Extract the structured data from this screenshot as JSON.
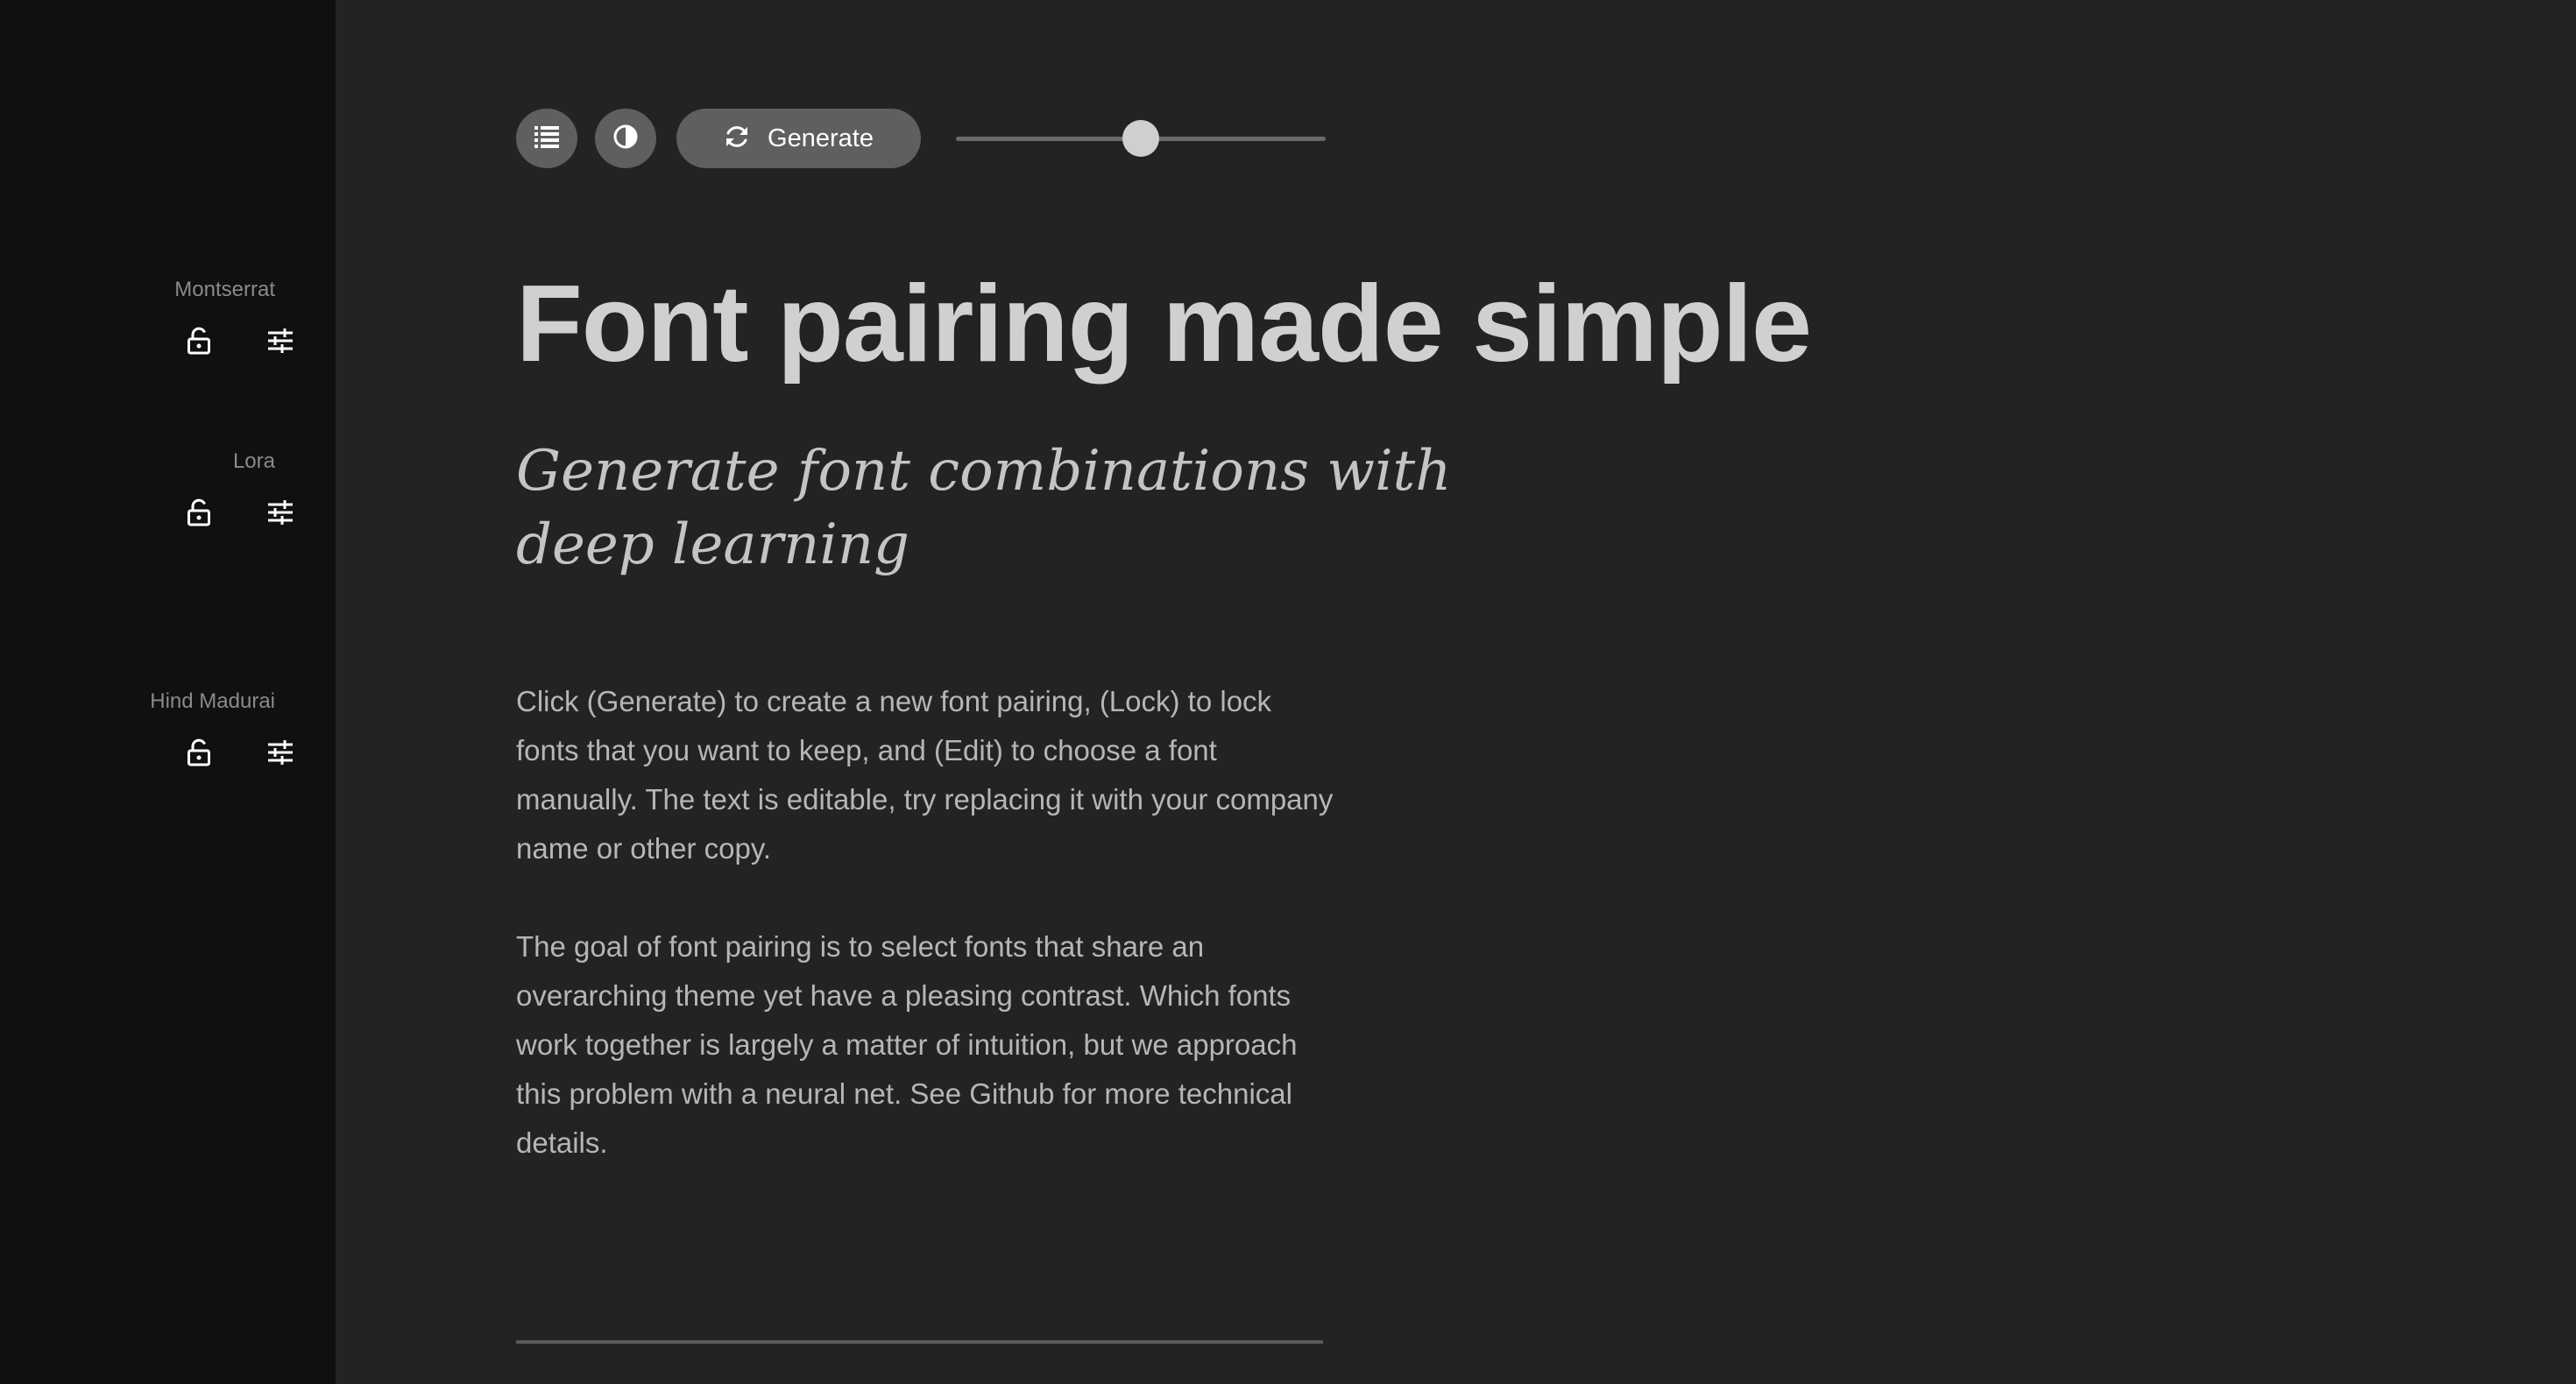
{
  "sidebar": {
    "fonts": [
      {
        "name": "Montserrat"
      },
      {
        "name": "Lora"
      },
      {
        "name": "Hind Madurai"
      }
    ]
  },
  "toolbar": {
    "list_icon": "list-icon",
    "contrast_icon": "contrast-icon",
    "generate_label": "Generate",
    "generate_icon": "refresh-icon",
    "slider_value": 0.5
  },
  "content": {
    "headline": "Font pairing made simple",
    "subheading": "Generate font combinations with deep learning",
    "paragraph_1": "Click (Generate) to create a new font pairing, (Lock) to lock fonts that you want to keep, and (Edit) to choose a font manually. The text is editable, try replacing it with your company name or other copy.",
    "paragraph_2": "The goal of font pairing is to select fonts that share an overarching theme yet have a pleasing contrast. Which fonts work together is largely a matter of intuition, but we approach this problem with a neural net. See Github for more technical details."
  },
  "colors": {
    "sidebar_bg": "#101010",
    "main_bg": "#232323",
    "button_bg": "#5f5f5f",
    "heading_text": "#d0d0d0",
    "body_text": "#b6b6b6"
  }
}
